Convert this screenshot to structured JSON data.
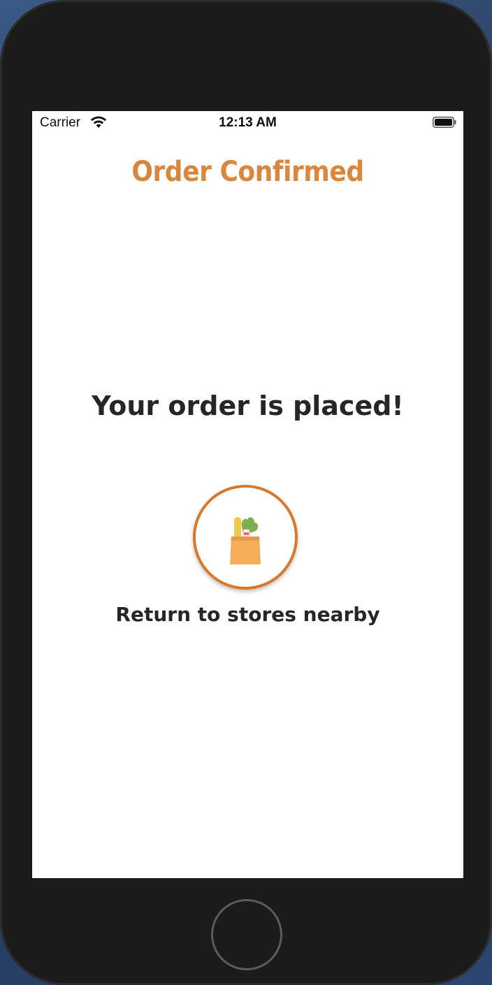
{
  "status_bar": {
    "carrier": "Carrier",
    "time": "12:13 AM"
  },
  "header": {
    "title": "Order Confirmed"
  },
  "main": {
    "headline": "Your order is placed!",
    "return_button_icon": "grocery-bag-icon",
    "return_label": "Return to stores nearby"
  },
  "colors": {
    "accent": "#d9873f",
    "ring": "#d9782d",
    "text": "#262626",
    "device": "#1b1b1b"
  }
}
